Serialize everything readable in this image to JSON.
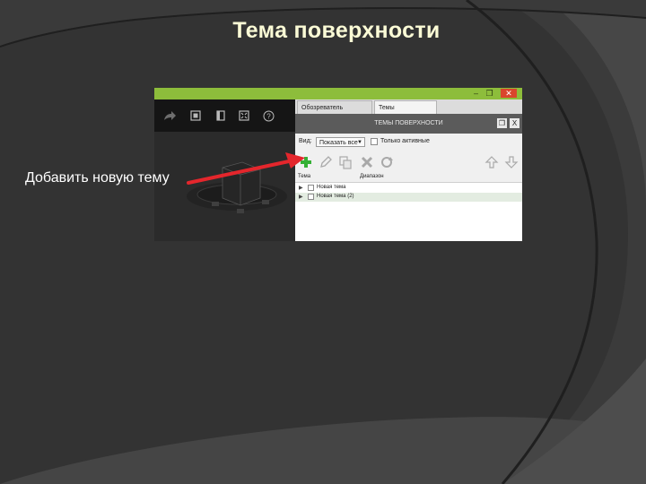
{
  "slide": {
    "title": "Тема поверхности",
    "callout": "Добавить новую тему"
  },
  "colors": {
    "background": "#2e2e2e",
    "title": "#fbfbd6",
    "arrow": "#e4262c",
    "accent_bar": "#8dbd3b",
    "close_button": "#d9452c"
  },
  "window": {
    "controls": {
      "minimize": "–",
      "maximize": "❐",
      "close": "✕"
    }
  },
  "viewport_toolbar": {
    "icons": [
      "share-icon",
      "zoom-window-icon",
      "book-icon",
      "fit-view-icon",
      "help-icon"
    ],
    "help_glyph": "?"
  },
  "panel": {
    "tabs": [
      {
        "label": "Обозреватель моделей",
        "active": false
      },
      {
        "label": "Темы поверхности",
        "active": true
      }
    ],
    "title": "ТЕМЫ ПОВЕРХНОСТИ",
    "title_buttons": {
      "restore": "❐",
      "close": "X"
    },
    "filter": {
      "view_label": "Вид:",
      "view_value": "Показать все",
      "only_active_label": "Только активные",
      "only_active_checked": false
    },
    "tools": [
      "add-icon",
      "edit-icon",
      "copy-icon",
      "delete-icon",
      "refresh-icon",
      "move-up-icon",
      "move-down-icon"
    ],
    "table": {
      "columns": [
        "Тема",
        "Диапазон"
      ],
      "rows": [
        {
          "name": "Новая тема",
          "selected": false
        },
        {
          "name": "Новая тема (2)",
          "selected": true
        }
      ]
    }
  }
}
